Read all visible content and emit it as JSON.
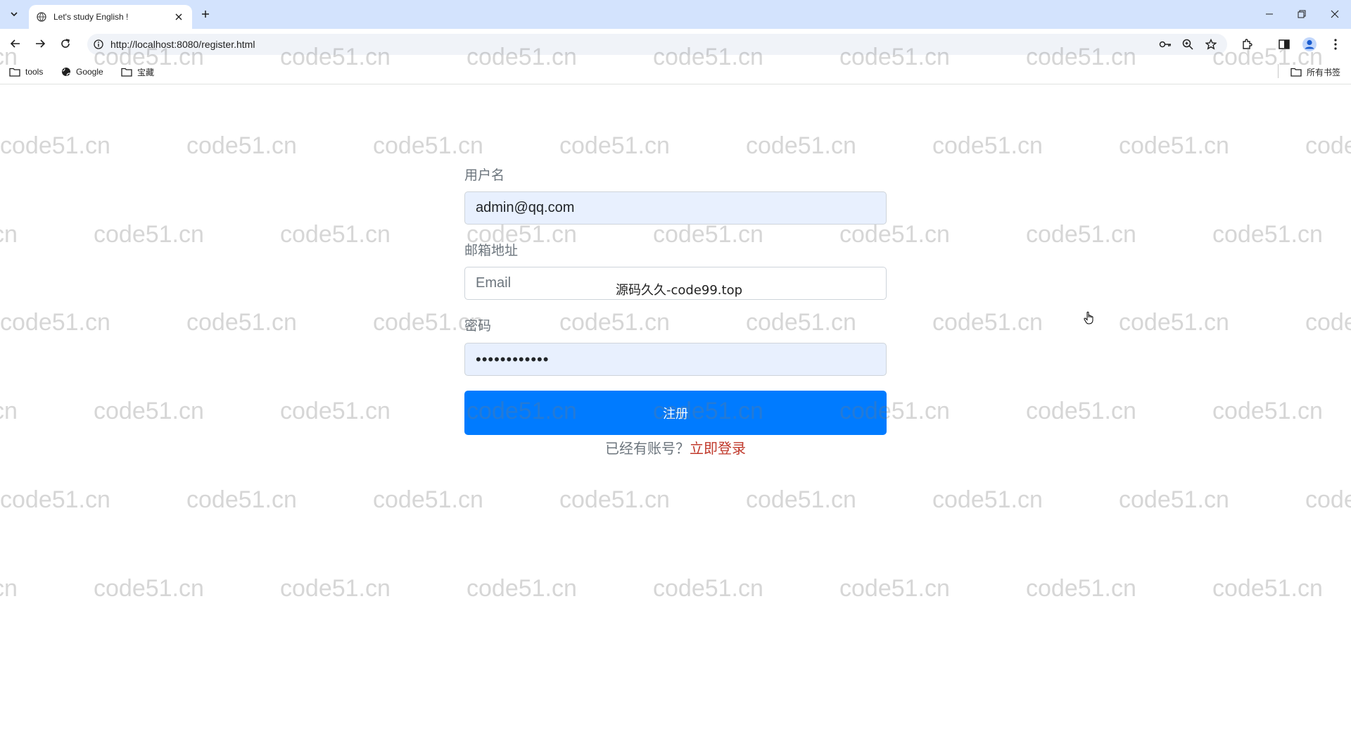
{
  "browser": {
    "tab_title": "Let's study English !",
    "url": "http://localhost:8080/register.html",
    "bookmarks": [
      {
        "label": "tools",
        "icon": "folder-icon"
      },
      {
        "label": "Google",
        "icon": "globe-icon"
      },
      {
        "label": "宝藏",
        "icon": "folder-icon"
      }
    ],
    "all_bookmarks_label": "所有书签"
  },
  "form": {
    "username_label": "用户名",
    "username_value": "admin@qq.com",
    "email_label": "邮箱地址",
    "email_placeholder": "Email",
    "password_label": "密码",
    "password_value": "••••••••••••",
    "submit_label": "注册",
    "have_account_text": "已经有账号？",
    "login_link": "立即登录"
  },
  "overlay_text": "源码久久-code99.top",
  "watermark_text": "code51.cn",
  "colors": {
    "tabstrip": "#d3e3fd",
    "primary_button": "#007bff",
    "autofill_bg": "#e8f0fe",
    "login_link": "#c0392b"
  }
}
